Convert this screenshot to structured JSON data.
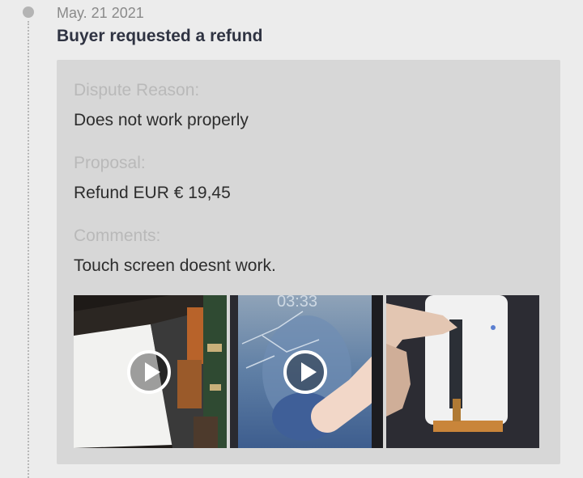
{
  "event": {
    "date": "May. 21 2021",
    "title": "Buyer requested a refund"
  },
  "dispute": {
    "reason_label": "Dispute Reason:",
    "reason_value": "Does not work properly",
    "proposal_label": "Proposal:",
    "proposal_value": "Refund EUR € 19,45",
    "comments_label": "Comments:",
    "comments_value": "Touch screen doesnt work."
  },
  "attachments": [
    {
      "kind": "video",
      "icon": "play-icon"
    },
    {
      "kind": "video",
      "icon": "play-icon",
      "overlay_text": "03:33"
    },
    {
      "kind": "image"
    }
  ],
  "colors": {
    "background": "#ececec",
    "card": "#d7d7d7",
    "title": "#2f3342",
    "label": "#b9b9b9",
    "value": "#2d2d2d",
    "timeline": "#b4b4b4"
  }
}
